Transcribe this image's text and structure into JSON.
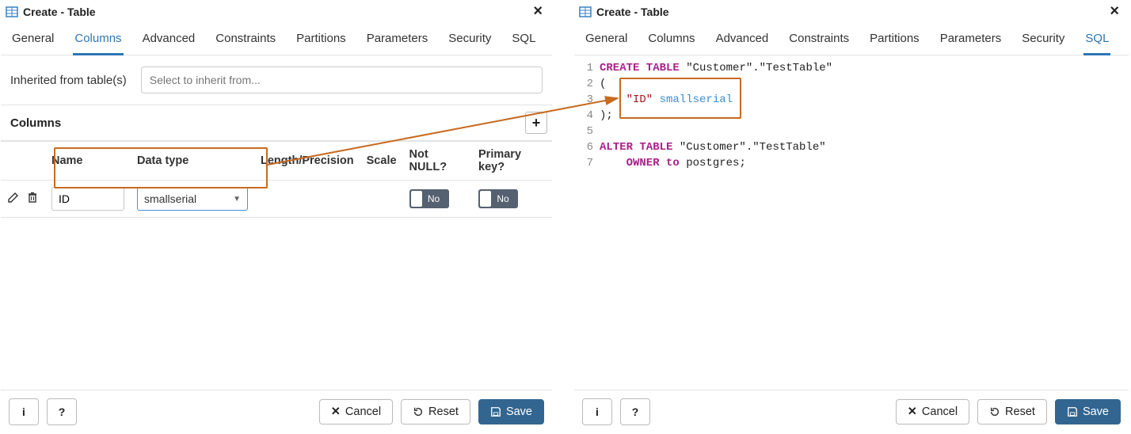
{
  "left": {
    "title": "Create - Table",
    "tabs": [
      "General",
      "Columns",
      "Advanced",
      "Constraints",
      "Partitions",
      "Parameters",
      "Security",
      "SQL"
    ],
    "active_tab": "Columns",
    "inherited_label": "Inherited from table(s)",
    "inherited_placeholder": "Select to inherit from...",
    "columns_label": "Columns",
    "headers": {
      "name": "Name",
      "datatype": "Data type",
      "length": "Length/Precision",
      "scale": "Scale",
      "notnull": "Not NULL?",
      "pkey": "Primary key?"
    },
    "row": {
      "name": "ID",
      "datatype": "smallserial",
      "notnull": "No",
      "pkey": "No"
    }
  },
  "right": {
    "title": "Create - Table",
    "tabs": [
      "General",
      "Columns",
      "Advanced",
      "Constraints",
      "Partitions",
      "Parameters",
      "Security",
      "SQL"
    ],
    "active_tab": "SQL",
    "sql": {
      "line1_kw": "CREATE TABLE",
      "line1_rest": " \"Customer\".\"TestTable\"",
      "line2": "(",
      "line3_str": "    \"ID\"",
      "line3_type": " smallserial",
      "line4": ");",
      "line5": "",
      "line6_kw": "ALTER TABLE",
      "line6_rest": " \"Customer\".\"TestTable\"",
      "line7_kw": "    OWNER to",
      "line7_rest": " postgres;"
    }
  },
  "footer": {
    "info": "i",
    "help": "?",
    "cancel": "Cancel",
    "reset": "Reset",
    "save": "Save"
  }
}
